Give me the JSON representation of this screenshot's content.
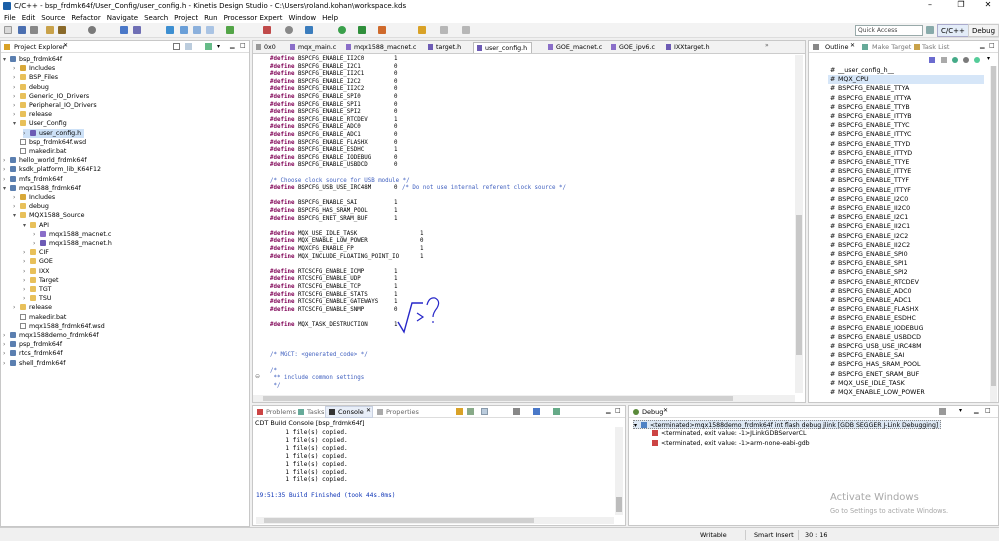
{
  "window": {
    "title": "C/C++ - bsp_frdmk64f/User_Config/user_config.h - Kinetis Design Studio - C:\\Users\\roland.kohan\\workspace.kds",
    "controls": [
      "–",
      "❐",
      "✕"
    ]
  },
  "menu": [
    "File",
    "Edit",
    "Source",
    "Refactor",
    "Navigate",
    "Search",
    "Project",
    "Run",
    "Processor Expert",
    "Window",
    "Help"
  ],
  "toolbar": {
    "quick_access": "Quick Access",
    "perspectives": [
      "C/C++",
      "Debug"
    ]
  },
  "project_explorer": {
    "title": "Project Explorer",
    "items": [
      {
        "label": "bsp_frdmk64f",
        "kind": "proj",
        "indent": 0,
        "tw": "▾"
      },
      {
        "label": "Includes",
        "kind": "pkg",
        "indent": 1,
        "tw": "›"
      },
      {
        "label": "BSP_Files",
        "kind": "fold",
        "indent": 1,
        "tw": "›"
      },
      {
        "label": "debug",
        "kind": "fold",
        "indent": 1,
        "tw": "›"
      },
      {
        "label": "Generic_IO_Drivers",
        "kind": "fold",
        "indent": 1,
        "tw": "›"
      },
      {
        "label": "Peripheral_IO_Drivers",
        "kind": "fold",
        "indent": 1,
        "tw": "›"
      },
      {
        "label": "release",
        "kind": "fold",
        "indent": 1,
        "tw": "›"
      },
      {
        "label": "User_Config",
        "kind": "fold",
        "indent": 1,
        "tw": "▾"
      },
      {
        "label": "user_config.h",
        "kind": "hfile",
        "indent": 2,
        "tw": "›",
        "selected": true
      },
      {
        "label": "bsp_frdmk64f.wsd",
        "kind": "file",
        "indent": 1,
        "tw": ""
      },
      {
        "label": "makedir.bat",
        "kind": "file",
        "indent": 1,
        "tw": ""
      },
      {
        "label": "hello_world_frdmk64f",
        "kind": "proj",
        "indent": 0,
        "tw": "›"
      },
      {
        "label": "ksdk_platform_lib_K64F12",
        "kind": "proj",
        "indent": 0,
        "tw": "›"
      },
      {
        "label": "mfs_frdmk64f",
        "kind": "proj",
        "indent": 0,
        "tw": "›"
      },
      {
        "label": "mqx1588_frdmk64f",
        "kind": "proj",
        "indent": 0,
        "tw": "▾"
      },
      {
        "label": "Includes",
        "kind": "pkg",
        "indent": 1,
        "tw": "›"
      },
      {
        "label": "debug",
        "kind": "fold",
        "indent": 1,
        "tw": "›"
      },
      {
        "label": "MQX1588_Source",
        "kind": "fold",
        "indent": 1,
        "tw": "▾"
      },
      {
        "label": "API",
        "kind": "fold",
        "indent": 2,
        "tw": "▾"
      },
      {
        "label": "mqx1588_macnet.c",
        "kind": "cfile",
        "indent": 3,
        "tw": "›"
      },
      {
        "label": "mqx1588_macnet.h",
        "kind": "hfile",
        "indent": 3,
        "tw": "›"
      },
      {
        "label": "CIF",
        "kind": "fold",
        "indent": 2,
        "tw": "›"
      },
      {
        "label": "GOE",
        "kind": "fold",
        "indent": 2,
        "tw": "›"
      },
      {
        "label": "IXX",
        "kind": "fold",
        "indent": 2,
        "tw": "›"
      },
      {
        "label": "Target",
        "kind": "fold",
        "indent": 2,
        "tw": "›"
      },
      {
        "label": "TGT",
        "kind": "fold",
        "indent": 2,
        "tw": "›"
      },
      {
        "label": "TSU",
        "kind": "fold",
        "indent": 2,
        "tw": "›"
      },
      {
        "label": "release",
        "kind": "fold",
        "indent": 1,
        "tw": "›"
      },
      {
        "label": "makedir.bat",
        "kind": "file",
        "indent": 1,
        "tw": ""
      },
      {
        "label": "mqx1588_frdmk64f.wsd",
        "kind": "file",
        "indent": 1,
        "tw": ""
      },
      {
        "label": "mqx1588demo_frdmk64f",
        "kind": "proj",
        "indent": 0,
        "tw": "›"
      },
      {
        "label": "psp_frdmk64f",
        "kind": "proj",
        "indent": 0,
        "tw": "›"
      },
      {
        "label": "rtcs_frdmk64f",
        "kind": "proj",
        "indent": 0,
        "tw": "›"
      },
      {
        "label": "shell_frdmk64f",
        "kind": "proj",
        "indent": 0,
        "tw": "›"
      }
    ]
  },
  "editor": {
    "tabs": [
      "0x0",
      "mqx_main.c",
      "mqx1588_macnet.c",
      "target.h",
      "user_config.h",
      "GOE_macnet.c",
      "GOE_ipv6.c",
      "IXXtarget.h"
    ],
    "active_tab": 4,
    "lines": [
      {
        "t": "def",
        "n": "BSPCFG_ENABLE_II2C0",
        "v": "1"
      },
      {
        "t": "def",
        "n": "BSPCFG_ENABLE_I2C1",
        "v": "0"
      },
      {
        "t": "def",
        "n": "BSPCFG_ENABLE_II2C1",
        "v": "0"
      },
      {
        "t": "def",
        "n": "BSPCFG_ENABLE_I2C2",
        "v": "0"
      },
      {
        "t": "def",
        "n": "BSPCFG_ENABLE_II2C2",
        "v": "0"
      },
      {
        "t": "def",
        "n": "BSPCFG_ENABLE_SPI0",
        "v": "0"
      },
      {
        "t": "def",
        "n": "BSPCFG_ENABLE_SPI1",
        "v": "0"
      },
      {
        "t": "def",
        "n": "BSPCFG_ENABLE_SPI2",
        "v": "0"
      },
      {
        "t": "def",
        "n": "BSPCFG_ENABLE_RTCDEV",
        "v": "1"
      },
      {
        "t": "def",
        "n": "BSPCFG_ENABLE_ADC0",
        "v": "0"
      },
      {
        "t": "def",
        "n": "BSPCFG_ENABLE_ADC1",
        "v": "0"
      },
      {
        "t": "def",
        "n": "BSPCFG_ENABLE_FLASHX",
        "v": "0"
      },
      {
        "t": "def",
        "n": "BSPCFG_ENABLE_ESDHC",
        "v": "1"
      },
      {
        "t": "def",
        "n": "BSPCFG_ENABLE_IODEBUG",
        "v": "0"
      },
      {
        "t": "def",
        "n": "BSPCFG_ENABLE_USBDCD",
        "v": "0"
      },
      {
        "t": "blank"
      },
      {
        "t": "comment",
        "c": "/* Choose clock source for USB module */"
      },
      {
        "t": "def",
        "n": "BSPCFG_USB_USE_IRC48M",
        "v": "0",
        "c": "/* Do not use internal referent clock source */"
      },
      {
        "t": "blank"
      },
      {
        "t": "def",
        "n": "BSPCFG_ENABLE_SAI",
        "v": "1"
      },
      {
        "t": "def",
        "n": "BSPCFG_HAS_SRAM_POOL",
        "v": "1"
      },
      {
        "t": "def",
        "n": "BSPCFG_ENET_SRAM_BUF",
        "v": "1"
      },
      {
        "t": "blank"
      },
      {
        "t": "def2",
        "n": "MQX_USE_IDLE_TASK",
        "v": "1"
      },
      {
        "t": "def2",
        "n": "MQX_ENABLE_LOW_POWER",
        "v": "0"
      },
      {
        "t": "def2",
        "n": "MQXCFG_ENABLE_FP",
        "v": "1"
      },
      {
        "t": "def2",
        "n": "MQX_INCLUDE_FLOATING_POINT_IO",
        "v": "1"
      },
      {
        "t": "blank"
      },
      {
        "t": "def",
        "n": "RTCSCFG_ENABLE_ICMP",
        "v": "1"
      },
      {
        "t": "def",
        "n": "RTCSCFG_ENABLE_UDP",
        "v": "1"
      },
      {
        "t": "def",
        "n": "RTCSCFG_ENABLE_TCP",
        "v": "1"
      },
      {
        "t": "def",
        "n": "RTCSCFG_ENABLE_STATS",
        "v": "1"
      },
      {
        "t": "def",
        "n": "RTCSCFG_ENABLE_GATEWAYS",
        "v": "1"
      },
      {
        "t": "def",
        "n": "RTCSCFG_ENABLE_SNMP",
        "v": "0"
      },
      {
        "t": "blank"
      },
      {
        "t": "def",
        "n": "MQX_TASK_DESTRUCTION",
        "v": "1"
      },
      {
        "t": "blank"
      },
      {
        "t": "blank"
      },
      {
        "t": "blank"
      },
      {
        "t": "comment",
        "c": "/* MGCT: <generated_code> */"
      },
      {
        "t": "blank"
      },
      {
        "t": "comment",
        "c": "/*"
      },
      {
        "t": "comment",
        "c": " ** include common settings"
      },
      {
        "t": "comment",
        "c": " */"
      }
    ],
    "keyword": "#define"
  },
  "outline": {
    "tabs": [
      "Outline",
      "Make Target",
      "Task List"
    ],
    "items": [
      "__user_config_h__",
      "MQX_CPU",
      "BSPCFG_ENABLE_TTYA",
      "BSPCFG_ENABLE_ITTYA",
      "BSPCFG_ENABLE_TTYB",
      "BSPCFG_ENABLE_ITTYB",
      "BSPCFG_ENABLE_TTYC",
      "BSPCFG_ENABLE_ITTYC",
      "BSPCFG_ENABLE_TTYD",
      "BSPCFG_ENABLE_ITTYD",
      "BSPCFG_ENABLE_TTYE",
      "BSPCFG_ENABLE_ITTYE",
      "BSPCFG_ENABLE_TTYF",
      "BSPCFG_ENABLE_ITTYF",
      "BSPCFG_ENABLE_I2C0",
      "BSPCFG_ENABLE_II2C0",
      "BSPCFG_ENABLE_I2C1",
      "BSPCFG_ENABLE_II2C1",
      "BSPCFG_ENABLE_I2C2",
      "BSPCFG_ENABLE_II2C2",
      "BSPCFG_ENABLE_SPI0",
      "BSPCFG_ENABLE_SPI1",
      "BSPCFG_ENABLE_SPI2",
      "BSPCFG_ENABLE_RTCDEV",
      "BSPCFG_ENABLE_ADC0",
      "BSPCFG_ENABLE_ADC1",
      "BSPCFG_ENABLE_FLASHX",
      "BSPCFG_ENABLE_ESDHC",
      "BSPCFG_ENABLE_IODEBUG",
      "BSPCFG_ENABLE_USBDCD",
      "BSPCFG_USB_USE_IRC48M",
      "BSPCFG_ENABLE_SAI",
      "BSPCFG_HAS_SRAM_POOL",
      "BSPCFG_ENET_SRAM_BUF",
      "MQX_USE_IDLE_TASK",
      "MQX_ENABLE_LOW_POWER"
    ],
    "selected": 1
  },
  "console": {
    "tabs": [
      "Problems",
      "Tasks",
      "Console",
      "Properties"
    ],
    "active_tab": 2,
    "header": "CDT Build Console [bsp_frdmk64f]",
    "lines": [
      "        1 file(s) copied.",
      "        1 file(s) copied.",
      "        1 file(s) copied.",
      "        1 file(s) copied.",
      "        1 file(s) copied.",
      "        1 file(s) copied.",
      "        1 file(s) copied."
    ],
    "finished": "19:51:35 Build Finished (took 44s.0ms)"
  },
  "debug": {
    "tab": "Debug",
    "items": [
      {
        "label": "<terminated>mqx1588demo_frdmk64f int flash debug jlink [GDB SEGGER J-Link Debugging]",
        "indent": 0
      },
      {
        "label": "<terminated, exit value: -1>JLinkGDBServerCL",
        "indent": 1
      },
      {
        "label": "<terminated, exit value: -1>arm-none-eabi-gdb",
        "indent": 1
      }
    ]
  },
  "watermark": {
    "line1": "Activate Windows",
    "line2": "Go to Settings to activate Windows."
  },
  "status": {
    "writable": "Writable",
    "insert": "Smart Insert",
    "position": "30 : 16"
  }
}
